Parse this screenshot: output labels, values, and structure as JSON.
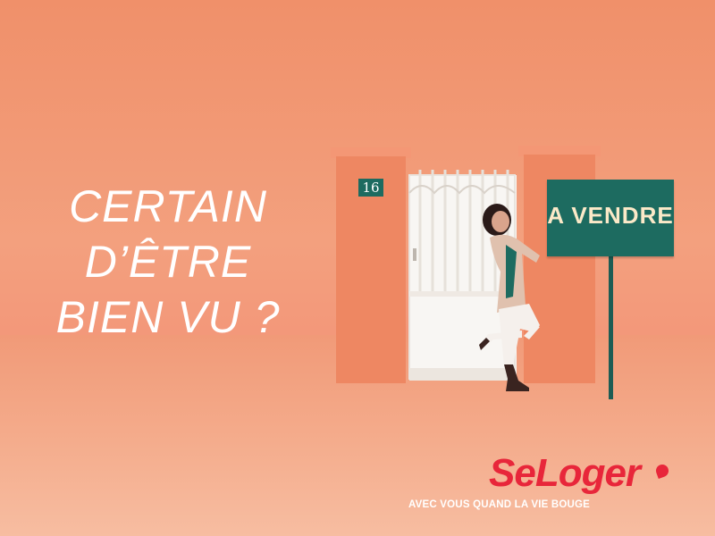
{
  "headline": {
    "lines": [
      "CERTAIN",
      "D’ÊTRE",
      "BIEN VU ?"
    ]
  },
  "scene": {
    "house_number": "16",
    "sign_text": "A VENDRE"
  },
  "brand": {
    "logo_text": "SeLoger",
    "tagline": "AVEC VOUS QUAND LA VIE BOUGE"
  },
  "colors": {
    "background": "#f0906a",
    "pillar": "#ee8762",
    "sign": "#1d6b60",
    "brand_red": "#e8263a"
  }
}
